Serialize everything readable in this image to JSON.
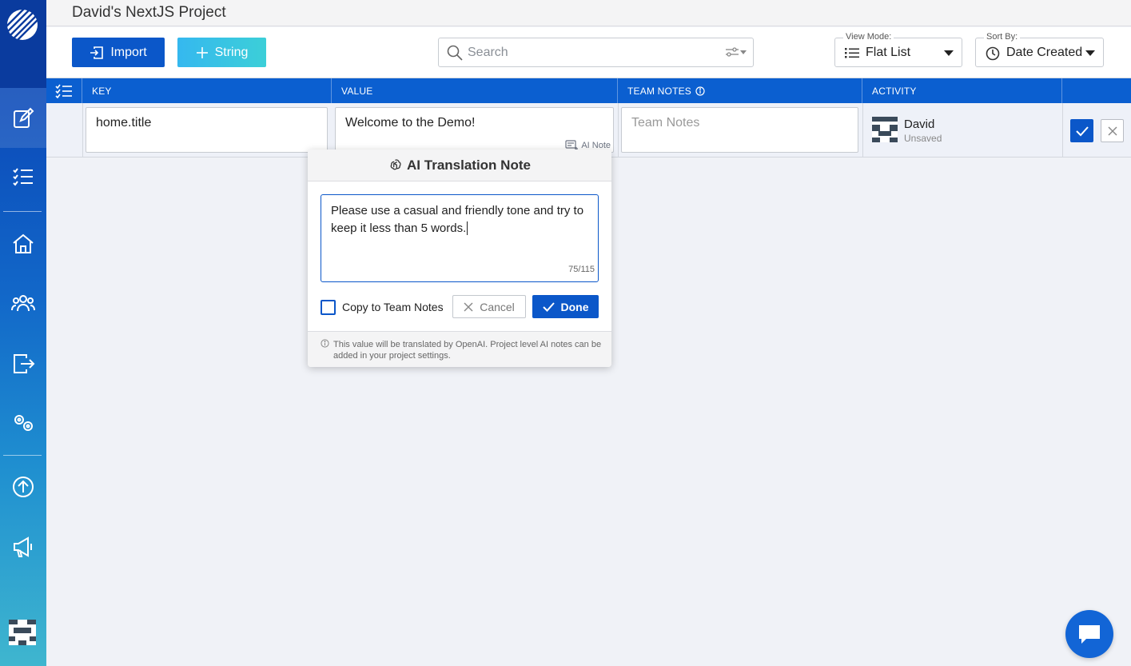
{
  "header": {
    "project_title": "David's NextJS Project"
  },
  "toolbar": {
    "import_label": "Import",
    "string_label": "String",
    "search_placeholder": "Search",
    "view_mode": {
      "label": "View Mode:",
      "value": "Flat List"
    },
    "sort_by": {
      "label": "Sort By:",
      "value": "Date Created"
    }
  },
  "table": {
    "columns": [
      "KEY",
      "VALUE",
      "TEAM NOTES",
      "ACTIVITY"
    ],
    "row": {
      "key": "home.title",
      "value": "Welcome to the Demo!",
      "ai_note_link": "AI Note",
      "team_notes_placeholder": "Team Notes",
      "activity_user": "David",
      "activity_status": "Unsaved"
    }
  },
  "popover": {
    "title": "AI Translation Note",
    "note_text": "Please use a casual and friendly tone and try to keep it less than 5 words.",
    "char_count": "75/115",
    "copy_label": "Copy to Team Notes",
    "copy_checked": false,
    "cancel_label": "Cancel",
    "done_label": "Done",
    "footer_text": "This value will be translated by OpenAI. Project level AI notes can be added in your project settings."
  },
  "colors": {
    "primary": "#0b57c9",
    "header_blue": "#0b5fd0",
    "string_button": "#35b8ef",
    "sidebar_top": "#0a3b9e",
    "sidebar_bottom": "#3fb6cf"
  },
  "sidebar": {
    "icons": [
      "logo-icon",
      "edit-icon",
      "checklist-icon",
      "home-icon",
      "team-icon",
      "export-icon",
      "settings-icon",
      "upload-icon",
      "megaphone-icon",
      "avatar"
    ]
  }
}
